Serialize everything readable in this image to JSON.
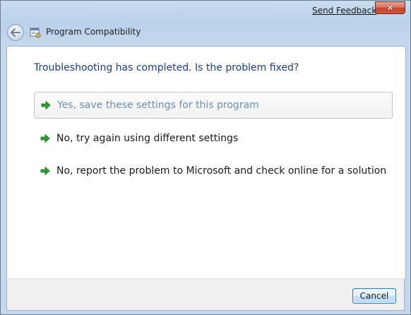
{
  "header": {
    "send_feedback": "Send Feedback",
    "title": "Program Compatibility"
  },
  "main": {
    "heading": "Troubleshooting has completed.  Is the problem fixed?",
    "options": [
      {
        "label": "Yes, save these settings for this program",
        "icon": "green-arrow-icon",
        "state": "hovered"
      },
      {
        "label": "No, try again using different settings",
        "icon": "green-arrow-icon",
        "state": "normal"
      },
      {
        "label": "No, report the problem to Microsoft and check online for a solution",
        "icon": "green-arrow-icon",
        "state": "normal"
      }
    ]
  },
  "footer": {
    "cancel_label": "Cancel"
  },
  "colors": {
    "heading": "#1e3d8f",
    "arrow": "#2e9e2e",
    "hover_text": "#6e8fb5"
  }
}
